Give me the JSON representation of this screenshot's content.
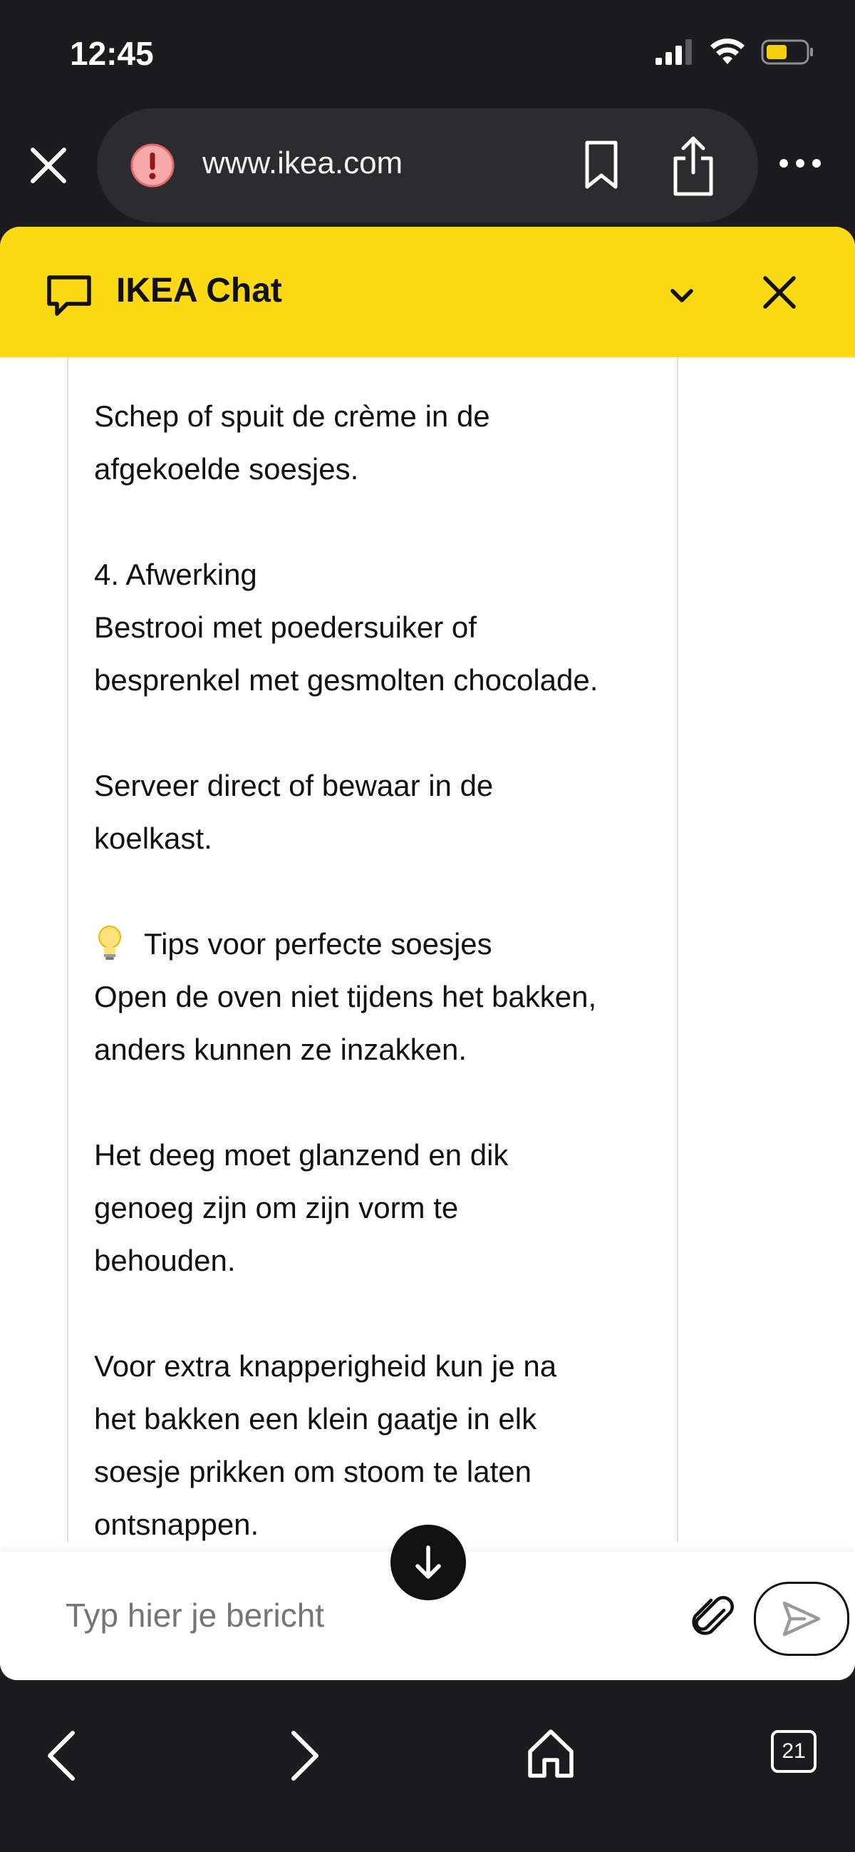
{
  "status_bar": {
    "time": "12:45"
  },
  "browser": {
    "url": "www.ikea.com"
  },
  "chat": {
    "title": "IKEA Chat",
    "message": {
      "paragraphs": [
        [
          "Schep of spuit de crème in de",
          "afgekoelde soesjes."
        ],
        [
          "4. Afwerking",
          "Bestrooi met poedersuiker of",
          "besprenkel met gesmolten chocolade."
        ],
        [
          "Serveer direct of bewaar in de",
          "koelkast."
        ],
        [
          "Tips voor perfecte soesjes",
          "Open de oven niet tijdens het bakken,",
          "anders kunnen ze inzakken."
        ],
        [
          "Het deeg moet glanzend en dik",
          "genoeg zijn om zijn vorm te",
          "behouden."
        ],
        [
          "Voor extra knapperigheid kun je na",
          "het bakken een klein gaatje in elk",
          "soesje prikken om stoom te laten",
          "ontsnappen."
        ]
      ]
    },
    "composer": {
      "placeholder": "Typ hier je bericht"
    }
  },
  "bottom_nav": {
    "tab_count": "21"
  },
  "colors": {
    "ikea_yellow": "#fbd914",
    "chrome_dark": "#1c1c1e"
  },
  "icons": [
    "close-icon",
    "alert-icon",
    "bookmark-icon",
    "share-icon",
    "more-icon",
    "chat-bubble-icon",
    "chevron-down-icon",
    "lightbulb-icon",
    "arrow-down-icon",
    "paperclip-icon",
    "send-icon",
    "back-icon",
    "forward-icon",
    "home-icon",
    "tabs-icon"
  ]
}
